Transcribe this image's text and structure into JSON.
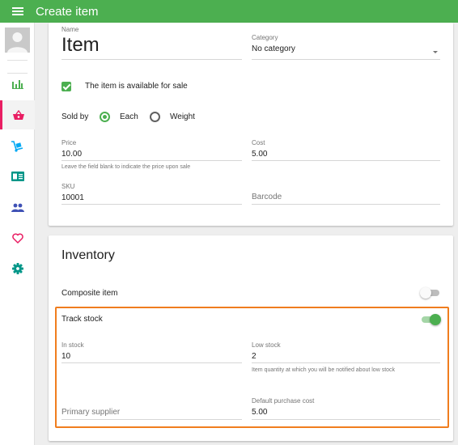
{
  "app": {
    "title": "Create item"
  },
  "theme": {
    "primary": "#4caf50",
    "accent": "#e91e63",
    "highlight": "#f07d1e"
  },
  "sidebar": {
    "items": [
      {
        "icon": "bar-chart-icon",
        "color": "#4caf50"
      },
      {
        "icon": "basket-icon",
        "color": "#e91e63",
        "active": true
      },
      {
        "icon": "hand-truck-icon",
        "color": "#03a9f4"
      },
      {
        "icon": "id-card-icon",
        "color": "#009688"
      },
      {
        "icon": "people-icon",
        "color": "#3f51b5"
      },
      {
        "icon": "heart-icon",
        "color": "#e91e63"
      },
      {
        "icon": "gear-icon",
        "color": "#009688"
      }
    ]
  },
  "item": {
    "name_label": "Name",
    "name_value": "Item",
    "category_label": "Category",
    "category_value": "No category",
    "available_label": "The item is available for sale",
    "available_checked": true,
    "sold_by_label": "Sold by",
    "sold_by_options": [
      "Each",
      "Weight"
    ],
    "sold_by_selected": "Each",
    "price_label": "Price",
    "price_value": "10.00",
    "price_hint": "Leave the field blank to indicate the price upon sale",
    "cost_label": "Cost",
    "cost_value": "5.00",
    "sku_label": "SKU",
    "sku_value": "10001",
    "barcode_placeholder": "Barcode"
  },
  "inventory": {
    "title": "Inventory",
    "composite_label": "Composite item",
    "composite_on": false,
    "track_stock_label": "Track stock",
    "track_stock_on": true,
    "in_stock_label": "In stock",
    "in_stock_value": "10",
    "low_stock_label": "Low stock",
    "low_stock_value": "2",
    "low_stock_hint": "Item quantity at which you will be notified about low stock",
    "supplier_placeholder": "Primary supplier",
    "purchase_cost_label": "Default purchase cost",
    "purchase_cost_value": "5.00"
  }
}
